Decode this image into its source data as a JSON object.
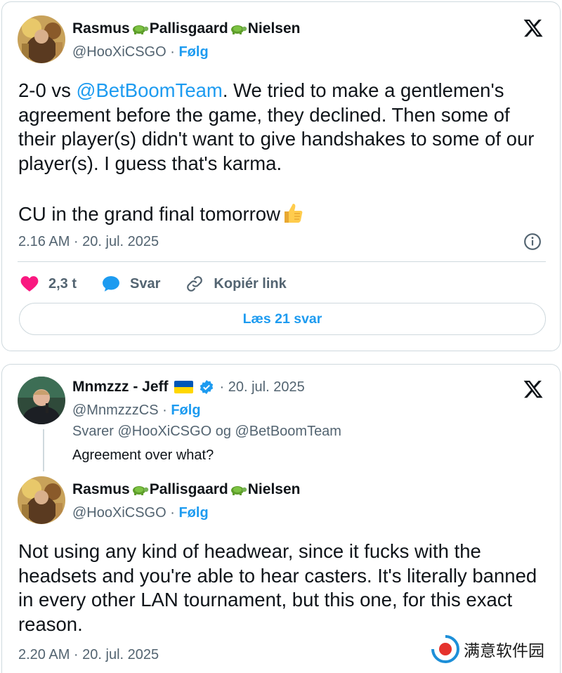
{
  "tweet1": {
    "display_name_parts": [
      "Rasmus",
      "Pallisgaard",
      "Nielsen"
    ],
    "handle": "@HooXiCSGO",
    "separator": "·",
    "follow_label": "Følg",
    "text_mention": "@BetBoomTeam",
    "text_pre": "2-0 vs ",
    "text_post": ". We tried to make a gentlemen's agreement before the game, they declined. Then some of their player(s) didn't want to give handshakes to some of our player(s). I guess that's karma.",
    "text_line2": "CU in the grand final tomorrow",
    "emoji": "thumbs-up",
    "timestamp": "2.16 AM · 20. jul. 2025",
    "actions": {
      "like_count": "2,3 t",
      "reply_label": "Svar",
      "copy_label": "Kopiér link"
    },
    "read_replies_label": "Læs 21 svar"
  },
  "tweet2": {
    "reply": {
      "display_name": "Mnmzzz - Jeff",
      "handle": "@MnmzzzCS",
      "separator": "·",
      "date": "· 20. jul. 2025",
      "follow_label": "Følg",
      "replying_to": "Svarer @HooXiCSGO og @BetBoomTeam",
      "text": "Agreement over what?"
    },
    "answer": {
      "display_name_parts": [
        "Rasmus",
        "Pallisgaard",
        "Nielsen"
      ],
      "handle": "@HooXiCSGO",
      "separator": "·",
      "follow_label": "Følg",
      "text": "Not using any kind of headwear, since it fucks with the headsets and you're able to hear casters. It's literally banned in every other LAN tournament, but this one, for this exact reason.",
      "timestamp": "2.20 AM · 20. jul. 2025"
    }
  },
  "watermark": {
    "text": "满意软件园"
  },
  "colors": {
    "accent": "#1d9bf0",
    "like": "#f91880",
    "muted": "#536471",
    "border": "#cfd9de"
  }
}
